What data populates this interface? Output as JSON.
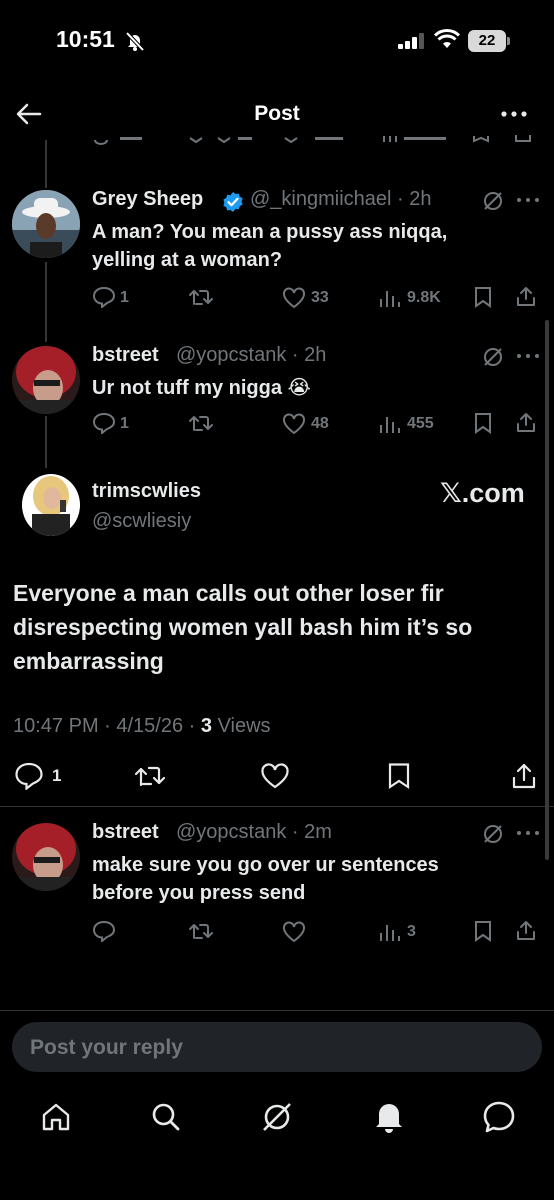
{
  "status_bar": {
    "time": "10:51",
    "battery": "22"
  },
  "header": {
    "title": "Post"
  },
  "replies_above": [
    {
      "name": "Grey Sheep",
      "handle": "@_kingmiichael",
      "time": "2h",
      "text_line1": "A man? You mean a pussy ass niqqa,",
      "text_line2": "yelling at a woman?",
      "replies": "1",
      "likes": "33",
      "views": "9.8K"
    },
    {
      "name": "bstreet",
      "handle": "@yopcstank",
      "time": "2h",
      "text_line1": "Ur not tuff my nigga 😭",
      "replies": "1",
      "likes": "48",
      "views": "455"
    }
  ],
  "main_post": {
    "name": "trimscwlies",
    "handle": "@scwliesiy",
    "watermark": "𝕏.com",
    "text": "Everyone a man calls out other loser fir disrespecting women yall bash him it’s so embarrassing",
    "timestamp": "10:47 PM · 4/15/26 · ",
    "views_count": "3",
    "views_label": " Views",
    "replies": "1"
  },
  "reply_below": {
    "name": "bstreet",
    "handle": "@yopcstank",
    "time": "2m",
    "text_line1": "make sure you go over ur sentences",
    "text_line2": "before you press send",
    "views": "3"
  },
  "composer": {
    "placeholder": "Post your reply"
  },
  "bottom_nav": [
    "home-icon",
    "search-icon",
    "grok-icon",
    "notifications-icon",
    "messages-icon"
  ],
  "colors": {
    "background": "#000000",
    "text": "#e7e9ea",
    "muted": "#71767b",
    "verified": "#1d9bf0"
  }
}
